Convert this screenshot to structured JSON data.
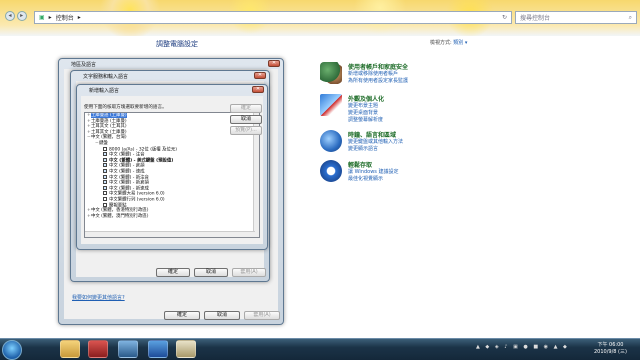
{
  "explorer": {
    "breadcrumb": "控制台",
    "search_placeholder": "搜尋控制台"
  },
  "control_panel": {
    "title": "調整電腦設定",
    "view_by_label": "檢視方式:",
    "view_by_value": "類別 ▾",
    "categories": [
      {
        "title": "使用者帳戶和家庭安全",
        "links": [
          "新增或移除使用者帳戶",
          "為所有使用者設定家長監護"
        ]
      },
      {
        "title": "外觀及個人化",
        "links": [
          "變更布景主題",
          "變更桌面背景",
          "調整螢幕解析度"
        ]
      },
      {
        "title": "時鐘、語言和區域",
        "links": [
          "變更鍵盤或其他輸入方法",
          "變更顯示語言"
        ]
      },
      {
        "title": "輕鬆存取",
        "links": [
          "讓 Windows 建議設定",
          "最佳化視覺顯示"
        ]
      }
    ]
  },
  "dialog_region": {
    "title": "地區及語言",
    "ok": "確定",
    "cancel": "取消",
    "apply": "套用(A)",
    "link": "我要如何變更其他語言?"
  },
  "dialog_text_services": {
    "title": "文字服務和輸入語言",
    "ok": "確定",
    "cancel": "取消",
    "apply": "套用(A)"
  },
  "dialog_add_input": {
    "title": "新增輸入語言",
    "instruction": "使用下面的核取方塊選取要新增的語言。",
    "ok": "確定",
    "cancel": "取消",
    "preview": "預覽(P)...",
    "tree": [
      {
        "text": "土庫曼語 (土庫曼)",
        "indent": 0,
        "exp": "+",
        "selected": true
      },
      {
        "text": "土庫曼語 (土庫曼)",
        "indent": 0,
        "exp": "+"
      },
      {
        "text": "土耳其文 (土耳其)",
        "indent": 0,
        "exp": "+"
      },
      {
        "text": "土耳其文 (土庫曼)",
        "indent": 0,
        "exp": "+"
      },
      {
        "text": "中文 (繁體，台灣)",
        "indent": 0,
        "exp": "−"
      },
      {
        "text": "鍵盤",
        "indent": 1,
        "exp": "−"
      },
      {
        "text": "8000 (a/As) - 32位 (版權 及位元)",
        "indent": 2,
        "cb": true
      },
      {
        "text": "中文 (繁體) - 注音",
        "indent": 2,
        "cb": true,
        "on": true
      },
      {
        "text": "中文 (繁體) - 美式鍵盤 (預設值)",
        "indent": 2,
        "cb": true,
        "on": true,
        "bold": true
      },
      {
        "text": "中文 (繁體) - 倉頡",
        "indent": 2,
        "cb": true,
        "on": true
      },
      {
        "text": "中文 (繁體) - 速成",
        "indent": 2,
        "cb": true,
        "on": true
      },
      {
        "text": "中文 (繁體) - 新注音",
        "indent": 2,
        "cb": true,
        "on": true
      },
      {
        "text": "中文 (繁體) - 新倉頡",
        "indent": 2,
        "cb": true,
        "on": true
      },
      {
        "text": "中文 (繁體) - 新速成",
        "indent": 2,
        "cb": true,
        "on": true
      },
      {
        "text": "中文繁體大易 (version 6.0)",
        "indent": 2,
        "cb": true
      },
      {
        "text": "中文繁體行列 (version 6.0)",
        "indent": 2,
        "cb": true
      },
      {
        "text": "簡報要點",
        "indent": 2,
        "cb": true
      },
      {
        "text": "中文 (繁體，香港特別行政區)",
        "indent": 0,
        "exp": "+"
      },
      {
        "text": "中文 (繁體，澳門特別行政區)",
        "indent": 0,
        "exp": "+"
      }
    ]
  },
  "taskbar": {
    "time": "下午 06:00",
    "date": "2010/9/8 (三)"
  }
}
